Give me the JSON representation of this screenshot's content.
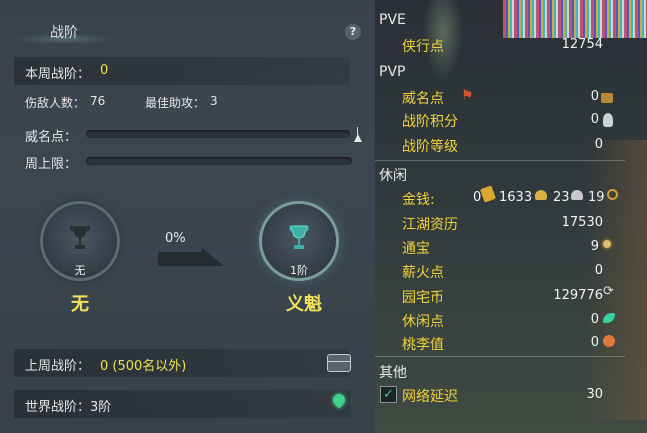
{
  "left": {
    "title": "战阶",
    "help": "?",
    "weekly_rank_label": "本周战阶：",
    "weekly_rank_value": "0",
    "kills_label": "伤敌人数：",
    "kills_value": "76",
    "assists_label": "最佳助攻：",
    "assists_value": "3",
    "prestige_label": "威名点：",
    "weekly_cap_label": "周上限：",
    "progress_pct": "0%",
    "current_medal_label": "无",
    "current_rank_name": "无",
    "next_medal_label": "1阶",
    "next_rank_name": "义魁",
    "last_week_label": "上周战阶：",
    "last_week_value": "0 (500名以外)",
    "world_rank": "世界战阶：3阶"
  },
  "right": {
    "pve_header": "PVE",
    "xiaxing_label": "侠行点",
    "xiaxing_value": "12754",
    "pvp_header": "PVP",
    "weiming_label": "威名点",
    "weiming_value": "0",
    "zhanjie_score_label": "战阶积分",
    "zhanjie_score_value": "0",
    "zhanjie_level_label": "战阶等级",
    "zhanjie_level_value": "0",
    "leisure_header": "休闲",
    "money_label": "金钱:",
    "money_ingot": "0",
    "money_gold": "1633",
    "money_silver": "23",
    "money_copper": "19",
    "jianghu_label": "江湖资历",
    "jianghu_value": "17530",
    "tongbao_label": "通宝",
    "tongbao_value": "9",
    "xinhuo_label": "薪火点",
    "xinhuo_value": "0",
    "yuanzhai_label": "园宅币",
    "yuanzhai_value": "129776",
    "xiuxian_label": "休闲点",
    "xiuxian_value": "0",
    "taoli_label": "桃李值",
    "taoli_value": "0",
    "other_header": "其他",
    "latency_label": "网络延迟",
    "latency_value": "30",
    "latency_checked": "✓"
  },
  "colors": {
    "accent_yellow": "#f2e24a",
    "label_gold": "#f2d23a",
    "panel_bg": "#3c464f"
  }
}
